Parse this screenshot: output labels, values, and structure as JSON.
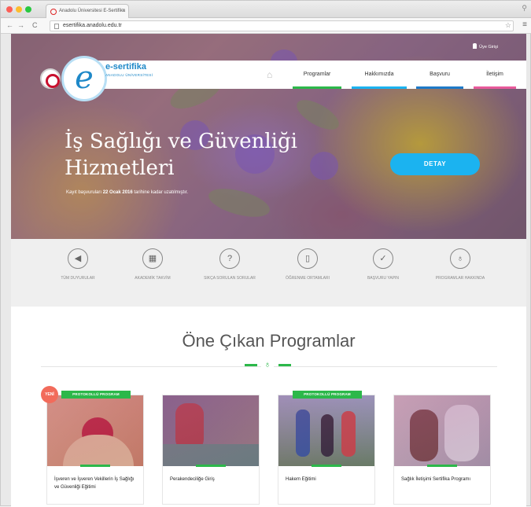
{
  "browser": {
    "tab_title": "Anadolu Üniversitesi E-Sertifika",
    "tab_close": "×",
    "url": "esertifika.anadolu.edu.tr",
    "back": "←",
    "forward": "→",
    "reload": "C",
    "menu": "≡",
    "star": "☆",
    "profile": "⚲"
  },
  "site": {
    "logo_text": "e-sertifika",
    "logo_sub": "ANADOLU ÜNİVERSİTESİ",
    "login_label": "Üye Girişi",
    "nav": [
      {
        "label": "Programlar",
        "color": "#2cb84a"
      },
      {
        "label": "Hakkımızda",
        "color": "#1bb3f0"
      },
      {
        "label": "Başvuru",
        "color": "#1e7ac8"
      },
      {
        "label": "İletişim",
        "color": "#e85a9b"
      }
    ]
  },
  "hero": {
    "title": "İş Sağlığı ve Güvenliği Hizmetleri",
    "sub_pre": "Kayıt başvuruları ",
    "sub_date": "22 Ocak 2016",
    "sub_post": " tarihine kadar uzatılmıştır.",
    "button": "DETAY"
  },
  "quick_links": [
    {
      "icon": "megaphone-icon",
      "glyph": "◀",
      "label": "TÜM DUYURULAR"
    },
    {
      "icon": "calendar-icon",
      "glyph": "▦",
      "label": "AKADEMİK TAKVİM"
    },
    {
      "icon": "question-icon",
      "glyph": "?",
      "label": "SIKÇA SORULAN SORULAR"
    },
    {
      "icon": "device-icon",
      "glyph": "▯",
      "label": "ÖĞRENME ORTAMLARI"
    },
    {
      "icon": "check-icon",
      "glyph": "✓",
      "label": "BAŞVURU YAPIN"
    },
    {
      "icon": "medal-icon",
      "glyph": "♁",
      "label": "PROGRAMLAR HAKKINDA"
    }
  ],
  "featured": {
    "title": "Öne Çıkan Programlar",
    "ribbon": "♁",
    "cards": [
      {
        "label": "İşveren ve İşveren Vekillerin İş Sağlığı ve Güvenliği Eğitimi",
        "badge": "PROTOKOLLÜ PROGRAM",
        "new": "YENİ"
      },
      {
        "label": "Perakendeciliğe Giriş",
        "badge": "",
        "new": ""
      },
      {
        "label": "Hakem Eğitimi",
        "badge": "PROTOKOLLÜ PROGRAM",
        "new": ""
      },
      {
        "label": "Sağlık İletişimi Sertifika Programı",
        "badge": "",
        "new": ""
      }
    ]
  }
}
